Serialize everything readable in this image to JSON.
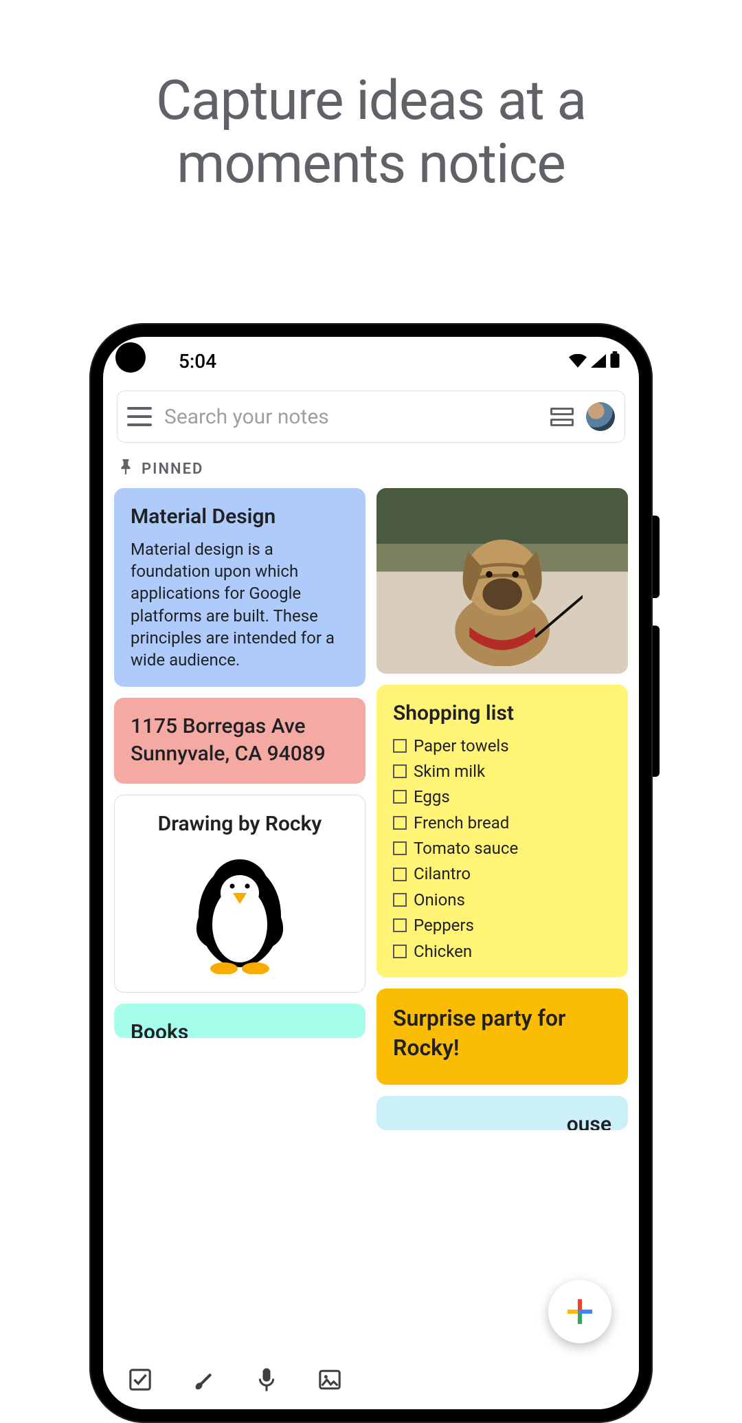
{
  "marketing": {
    "headline": "Capture ideas at a moments notice"
  },
  "statusbar": {
    "time": "5:04"
  },
  "search": {
    "placeholder": "Search your notes"
  },
  "section": {
    "pinned_label": "PINNED"
  },
  "notes": {
    "material": {
      "title": "Material Design",
      "body": "Material design is a foundation upon which applications for Google platforms are built. These principles are intended for a wide audience."
    },
    "address": {
      "body": "1175 Borregas Ave Sunnyvale, CA 94089"
    },
    "drawing": {
      "title": "Drawing by Rocky"
    },
    "books": {
      "title": "Books"
    },
    "shopping": {
      "title": "Shopping list",
      "items": [
        "Paper towels",
        "Skim milk",
        "Eggs",
        "French bread",
        "Tomato sauce",
        "Cilantro",
        "Onions",
        "Peppers",
        "Chicken"
      ]
    },
    "party": {
      "title": "Surprise party for Rocky!"
    },
    "house": {
      "title_fragment": "ouse"
    }
  },
  "icons": {
    "menu": "menu-icon",
    "layout": "layout-toggle-icon",
    "pin": "pin-icon",
    "wifi": "wifi-icon",
    "signal": "cellular-icon",
    "battery": "battery-icon",
    "checkbox_tool": "checkbox-tool-icon",
    "brush": "brush-icon",
    "mic": "microphone-icon",
    "image": "image-icon",
    "plus": "plus-icon"
  },
  "colors": {
    "blue": "#aecbfa",
    "pink": "#f5a9a3",
    "yellow": "#fff475",
    "orange": "#fbbc04",
    "teal": "#a7ffeb",
    "lightblue": "#cbf0f8"
  }
}
